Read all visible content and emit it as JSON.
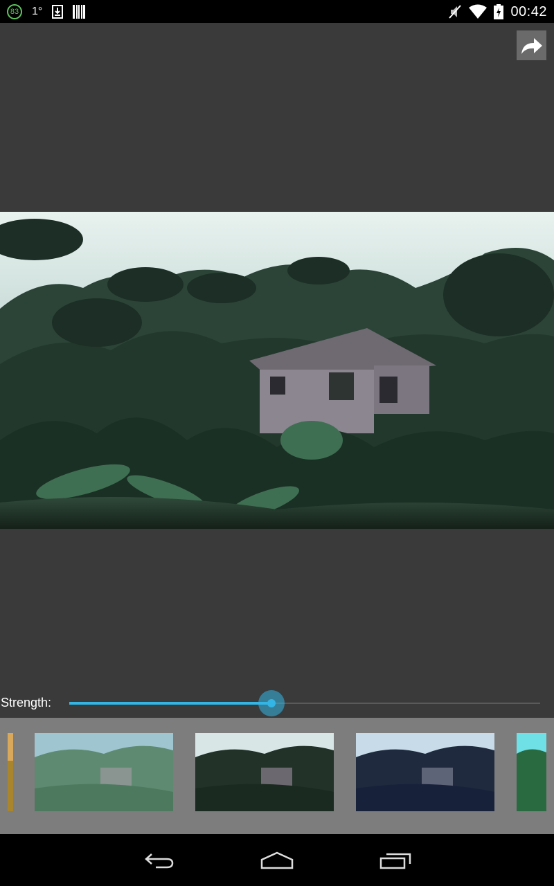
{
  "status_bar": {
    "battery_percent": "83",
    "temperature": "1°",
    "time": "00:42",
    "left_icons": [
      "battery-circle-icon",
      "download-icon",
      "barcode-icon"
    ],
    "right_icons": [
      "mute-icon",
      "wifi-icon",
      "battery-charging-icon"
    ]
  },
  "toolbar": {
    "share_icon": "share-icon"
  },
  "editor": {
    "strength_label": "Strength:",
    "strength_value": 0.43,
    "accent_color": "#33b5e5"
  },
  "filters": {
    "items": [
      {
        "name": "partial-left",
        "tint": "#c8a040"
      },
      {
        "name": "faded",
        "tint": "#6f8f7c"
      },
      {
        "name": "dark",
        "tint": "#2a3a30"
      },
      {
        "name": "blue",
        "tint": "#2a3550"
      },
      {
        "name": "partial-right",
        "tint": "#3aa080"
      }
    ]
  },
  "nav_bar": {
    "icons": [
      "back-icon",
      "home-icon",
      "recents-icon"
    ]
  }
}
